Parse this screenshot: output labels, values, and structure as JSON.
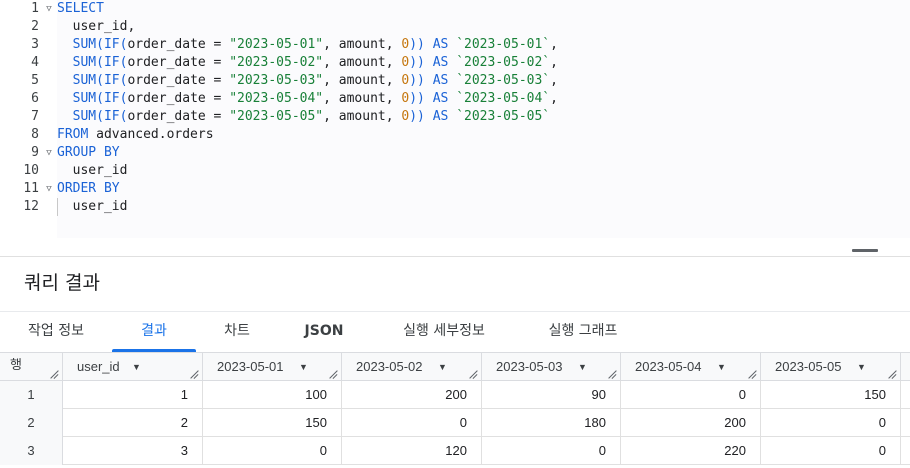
{
  "editor": {
    "lines": [
      {
        "num": "1",
        "fold": "▽",
        "parts": [
          {
            "t": "SELECT",
            "c": "kw"
          }
        ]
      },
      {
        "num": "2",
        "fold": "",
        "parts": [
          {
            "t": "  user_id,",
            "c": ""
          }
        ]
      },
      {
        "num": "3",
        "fold": "",
        "parts": [
          {
            "t": "  SUM(IF(",
            "c": "kw"
          },
          {
            "t": "order_date = ",
            "c": ""
          },
          {
            "t": "\"2023-05-01\"",
            "c": "str"
          },
          {
            "t": ", amount, ",
            "c": ""
          },
          {
            "t": "0",
            "c": "num"
          },
          {
            "t": ")) ",
            "c": "kw"
          },
          {
            "t": "AS ",
            "c": "kw"
          },
          {
            "t": "`2023-05-01`",
            "c": "str"
          },
          {
            "t": ",",
            "c": ""
          }
        ]
      },
      {
        "num": "4",
        "fold": "",
        "parts": [
          {
            "t": "  SUM(IF(",
            "c": "kw"
          },
          {
            "t": "order_date = ",
            "c": ""
          },
          {
            "t": "\"2023-05-02\"",
            "c": "str"
          },
          {
            "t": ", amount, ",
            "c": ""
          },
          {
            "t": "0",
            "c": "num"
          },
          {
            "t": ")) ",
            "c": "kw"
          },
          {
            "t": "AS ",
            "c": "kw"
          },
          {
            "t": "`2023-05-02`",
            "c": "str"
          },
          {
            "t": ",",
            "c": ""
          }
        ]
      },
      {
        "num": "5",
        "fold": "",
        "parts": [
          {
            "t": "  SUM(IF(",
            "c": "kw"
          },
          {
            "t": "order_date = ",
            "c": ""
          },
          {
            "t": "\"2023-05-03\"",
            "c": "str"
          },
          {
            "t": ", amount, ",
            "c": ""
          },
          {
            "t": "0",
            "c": "num"
          },
          {
            "t": ")) ",
            "c": "kw"
          },
          {
            "t": "AS ",
            "c": "kw"
          },
          {
            "t": "`2023-05-03`",
            "c": "str"
          },
          {
            "t": ",",
            "c": ""
          }
        ]
      },
      {
        "num": "6",
        "fold": "",
        "parts": [
          {
            "t": "  SUM(IF(",
            "c": "kw"
          },
          {
            "t": "order_date = ",
            "c": ""
          },
          {
            "t": "\"2023-05-04\"",
            "c": "str"
          },
          {
            "t": ", amount, ",
            "c": ""
          },
          {
            "t": "0",
            "c": "num"
          },
          {
            "t": ")) ",
            "c": "kw"
          },
          {
            "t": "AS ",
            "c": "kw"
          },
          {
            "t": "`2023-05-04`",
            "c": "str"
          },
          {
            "t": ",",
            "c": ""
          }
        ]
      },
      {
        "num": "7",
        "fold": "",
        "parts": [
          {
            "t": "  SUM(IF(",
            "c": "kw"
          },
          {
            "t": "order_date = ",
            "c": ""
          },
          {
            "t": "\"2023-05-05\"",
            "c": "str"
          },
          {
            "t": ", amount, ",
            "c": ""
          },
          {
            "t": "0",
            "c": "num"
          },
          {
            "t": ")) ",
            "c": "kw"
          },
          {
            "t": "AS ",
            "c": "kw"
          },
          {
            "t": "`2023-05-05`",
            "c": "str"
          }
        ]
      },
      {
        "num": "8",
        "fold": "",
        "parts": [
          {
            "t": "FROM ",
            "c": "kw"
          },
          {
            "t": "advanced.orders",
            "c": ""
          }
        ]
      },
      {
        "num": "9",
        "fold": "▽",
        "parts": [
          {
            "t": "GROUP BY",
            "c": "kw"
          }
        ]
      },
      {
        "num": "10",
        "fold": "",
        "parts": [
          {
            "t": "  user_id",
            "c": ""
          }
        ]
      },
      {
        "num": "11",
        "fold": "▽",
        "parts": [
          {
            "t": "ORDER BY",
            "c": "kw"
          }
        ]
      },
      {
        "num": "12",
        "fold": "",
        "parts": [
          {
            "t": "  user_id",
            "c": ""
          }
        ]
      }
    ]
  },
  "results": {
    "title": "쿼리 결과",
    "tabs": [
      {
        "label": "작업 정보",
        "active": false,
        "bold": false
      },
      {
        "label": "결과",
        "active": true,
        "bold": false
      },
      {
        "label": "차트",
        "active": false,
        "bold": false
      },
      {
        "label": "JSON",
        "active": false,
        "bold": true
      },
      {
        "label": "실행 세부정보",
        "active": false,
        "bold": false
      },
      {
        "label": "실행 그래프",
        "active": false,
        "bold": false
      }
    ],
    "table": {
      "row_header": "행",
      "columns": [
        "user_id",
        "2023-05-01",
        "2023-05-02",
        "2023-05-03",
        "2023-05-04",
        "2023-05-05"
      ],
      "rows": [
        {
          "row": "1",
          "values": [
            "1",
            "100",
            "200",
            "90",
            "0",
            "150"
          ]
        },
        {
          "row": "2",
          "values": [
            "2",
            "150",
            "0",
            "180",
            "200",
            "0"
          ]
        },
        {
          "row": "3",
          "values": [
            "3",
            "0",
            "120",
            "0",
            "220",
            "0"
          ]
        }
      ]
    }
  },
  "colors": {
    "keyword": "#1a62d6",
    "string": "#188038",
    "number": "#c5760d",
    "accent": "#1a73e8"
  }
}
